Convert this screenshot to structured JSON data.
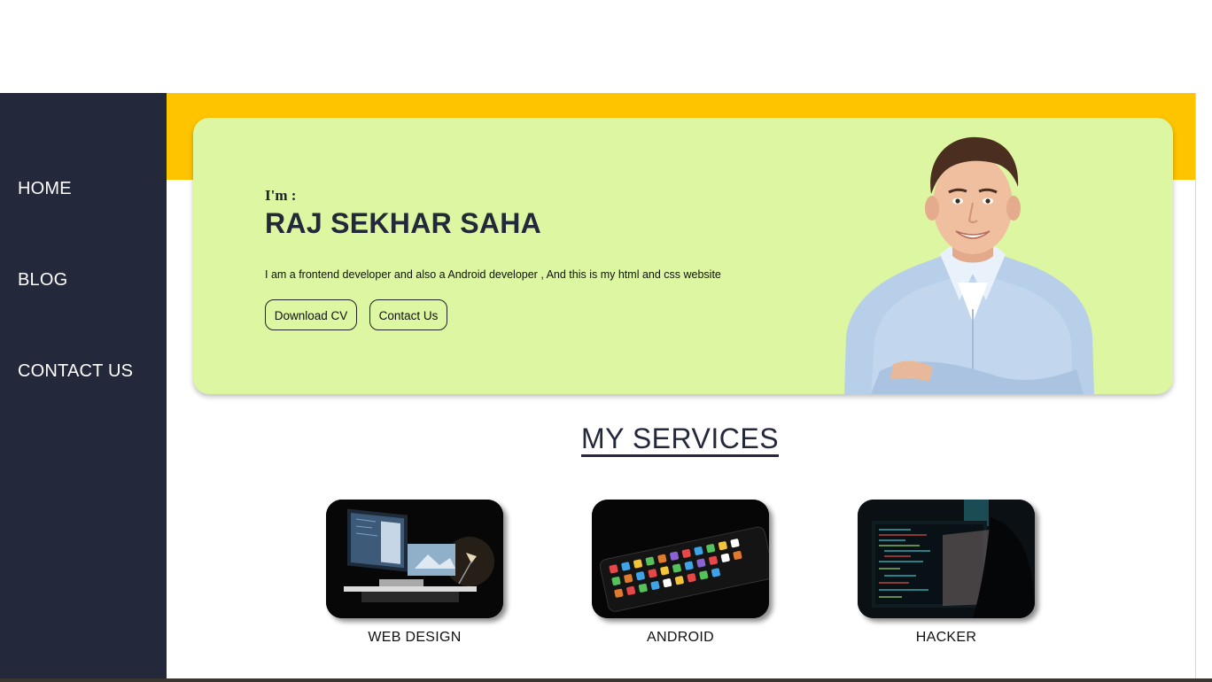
{
  "nav": {
    "items": [
      {
        "label": "HOME"
      },
      {
        "label": "BLOG"
      },
      {
        "label": "CONTACT US"
      }
    ]
  },
  "hero": {
    "intro": "I'm :",
    "name": "RAJ SEKHAR SAHA",
    "description": "I am a frontend developer and also a Android developer , And this is my html and css website",
    "buttons": {
      "download_cv": "Download CV",
      "contact_us": "Contact Us"
    }
  },
  "services": {
    "title": "MY SERVICES",
    "items": [
      {
        "label": "WEB DESIGN"
      },
      {
        "label": "ANDROID"
      },
      {
        "label": "HACKER"
      }
    ]
  },
  "colors": {
    "sidebar": "#23283b",
    "accent_band": "#ffc400",
    "hero_card": "#dcf6a1"
  }
}
